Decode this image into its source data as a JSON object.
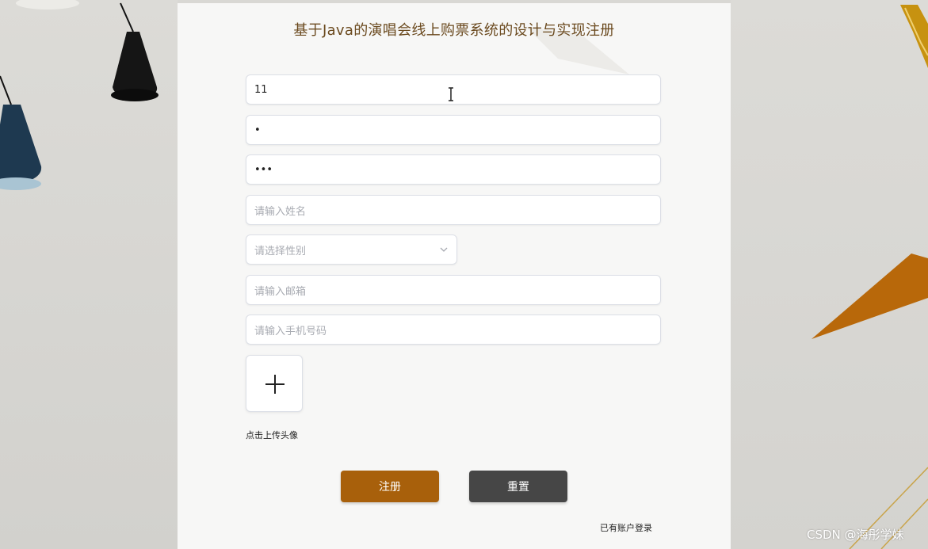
{
  "title": "基于Java的演唱会线上购票系统的设计与实现注册",
  "form": {
    "account": {
      "value": "11"
    },
    "password": {
      "value": "•"
    },
    "confirm_password": {
      "value": "•••"
    },
    "name": {
      "placeholder": "请输入姓名"
    },
    "gender": {
      "placeholder": "请选择性别"
    },
    "email": {
      "placeholder": "请输入邮箱"
    },
    "phone": {
      "placeholder": "请输入手机号码"
    },
    "avatar": {
      "label": "点击上传头像",
      "icon": "plus-icon"
    }
  },
  "buttons": {
    "register": "注册",
    "reset": "重置"
  },
  "login_link": "已有账户登录",
  "watermark": "CSDN @海彤学妹",
  "colors": {
    "accent": "#a8600b",
    "reset_button": "#464646",
    "title": "#6b4a1f",
    "placeholder": "#a8abb2"
  }
}
